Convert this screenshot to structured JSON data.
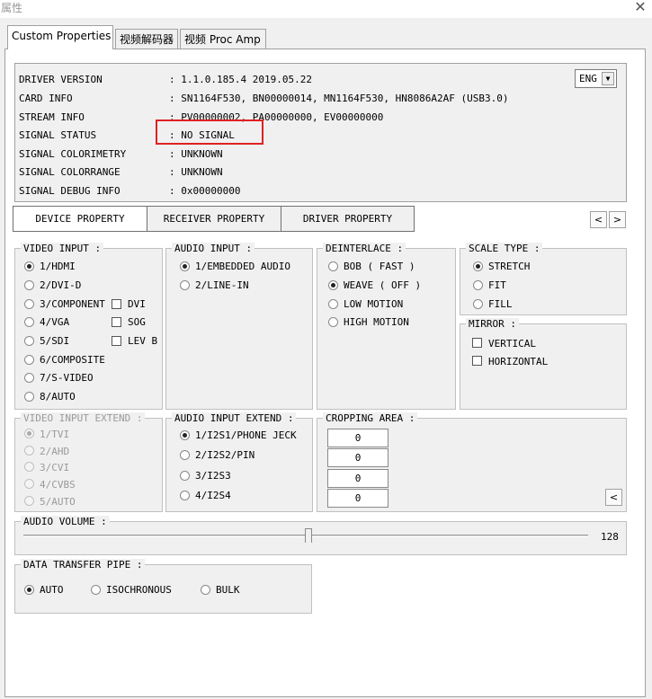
{
  "window": {
    "title": "属性",
    "close_glyph": "✕"
  },
  "tabs": [
    "Custom Properties",
    "视频解码器",
    "视频 Proc Amp"
  ],
  "info": {
    "rows": [
      {
        "label": "DRIVER VERSION",
        "value": ": 1.1.0.185.4 2019.05.22"
      },
      {
        "label": "CARD INFO",
        "value": ": SN1164F530, BN00000014, MN1164F530, HN8086A2AF (USB3.0)"
      },
      {
        "label": "STREAM INFO",
        "value": ": PV00000002, PA00000000, EV00000000"
      },
      {
        "label": "SIGNAL STATUS",
        "value": ": NO SIGNAL"
      },
      {
        "label": "SIGNAL COLORIMETRY",
        "value": ": UNKNOWN"
      },
      {
        "label": "SIGNAL COLORRANGE",
        "value": ": UNKNOWN"
      },
      {
        "label": "SIGNAL DEBUG INFO",
        "value": ": 0x00000000"
      }
    ],
    "language": "ENG",
    "language_arrow": "▼",
    "highlight_color": "#e02020"
  },
  "property_tabs": [
    "DEVICE PROPERTY",
    "RECEIVER PROPERTY",
    "DRIVER PROPERTY"
  ],
  "nav_arrows": {
    "prev": "<",
    "next": ">"
  },
  "video_input": {
    "label": "VIDEO INPUT :",
    "options": [
      "1/HDMI",
      "2/DVI-D",
      "3/COMPONENT",
      "4/VGA",
      "5/SDI",
      "6/COMPOSITE",
      "7/S-VIDEO",
      "8/AUTO"
    ],
    "checks": [
      "DVI",
      "SOG",
      "LEV B"
    ]
  },
  "audio_input": {
    "label": "AUDIO INPUT :",
    "options": [
      "1/EMBEDDED AUDIO",
      "2/LINE-IN"
    ]
  },
  "deinterlace": {
    "label": "DEINTERLACE :",
    "options": [
      "BOB ( FAST )",
      "WEAVE ( OFF )",
      "LOW MOTION",
      "HIGH MOTION"
    ]
  },
  "scale_type": {
    "label": "SCALE TYPE :",
    "options": [
      "STRETCH",
      "FIT",
      "FILL"
    ]
  },
  "mirror": {
    "label": "MIRROR :",
    "options": [
      "VERTICAL",
      "HORIZONTAL"
    ]
  },
  "video_input_extend": {
    "label": "VIDEO INPUT EXTEND :",
    "options": [
      "1/TVI",
      "2/AHD",
      "3/CVI",
      "4/CVBS",
      "5/AUTO"
    ]
  },
  "audio_input_extend": {
    "label": "AUDIO INPUT EXTEND :",
    "options": [
      "1/I2S1/PHONE JECK",
      "2/I2S2/PIN",
      "3/I2S3",
      "4/I2S4"
    ]
  },
  "cropping": {
    "label": "CROPPING AREA :",
    "values": [
      "0",
      "0",
      "0",
      "0"
    ],
    "arrow": "<"
  },
  "audio_volume": {
    "label": "AUDIO VOLUME :",
    "value": "128"
  },
  "data_pipe": {
    "label": "DATA TRANSFER PIPE :",
    "options": [
      "AUTO",
      "ISOCHRONOUS",
      "BULK"
    ]
  }
}
